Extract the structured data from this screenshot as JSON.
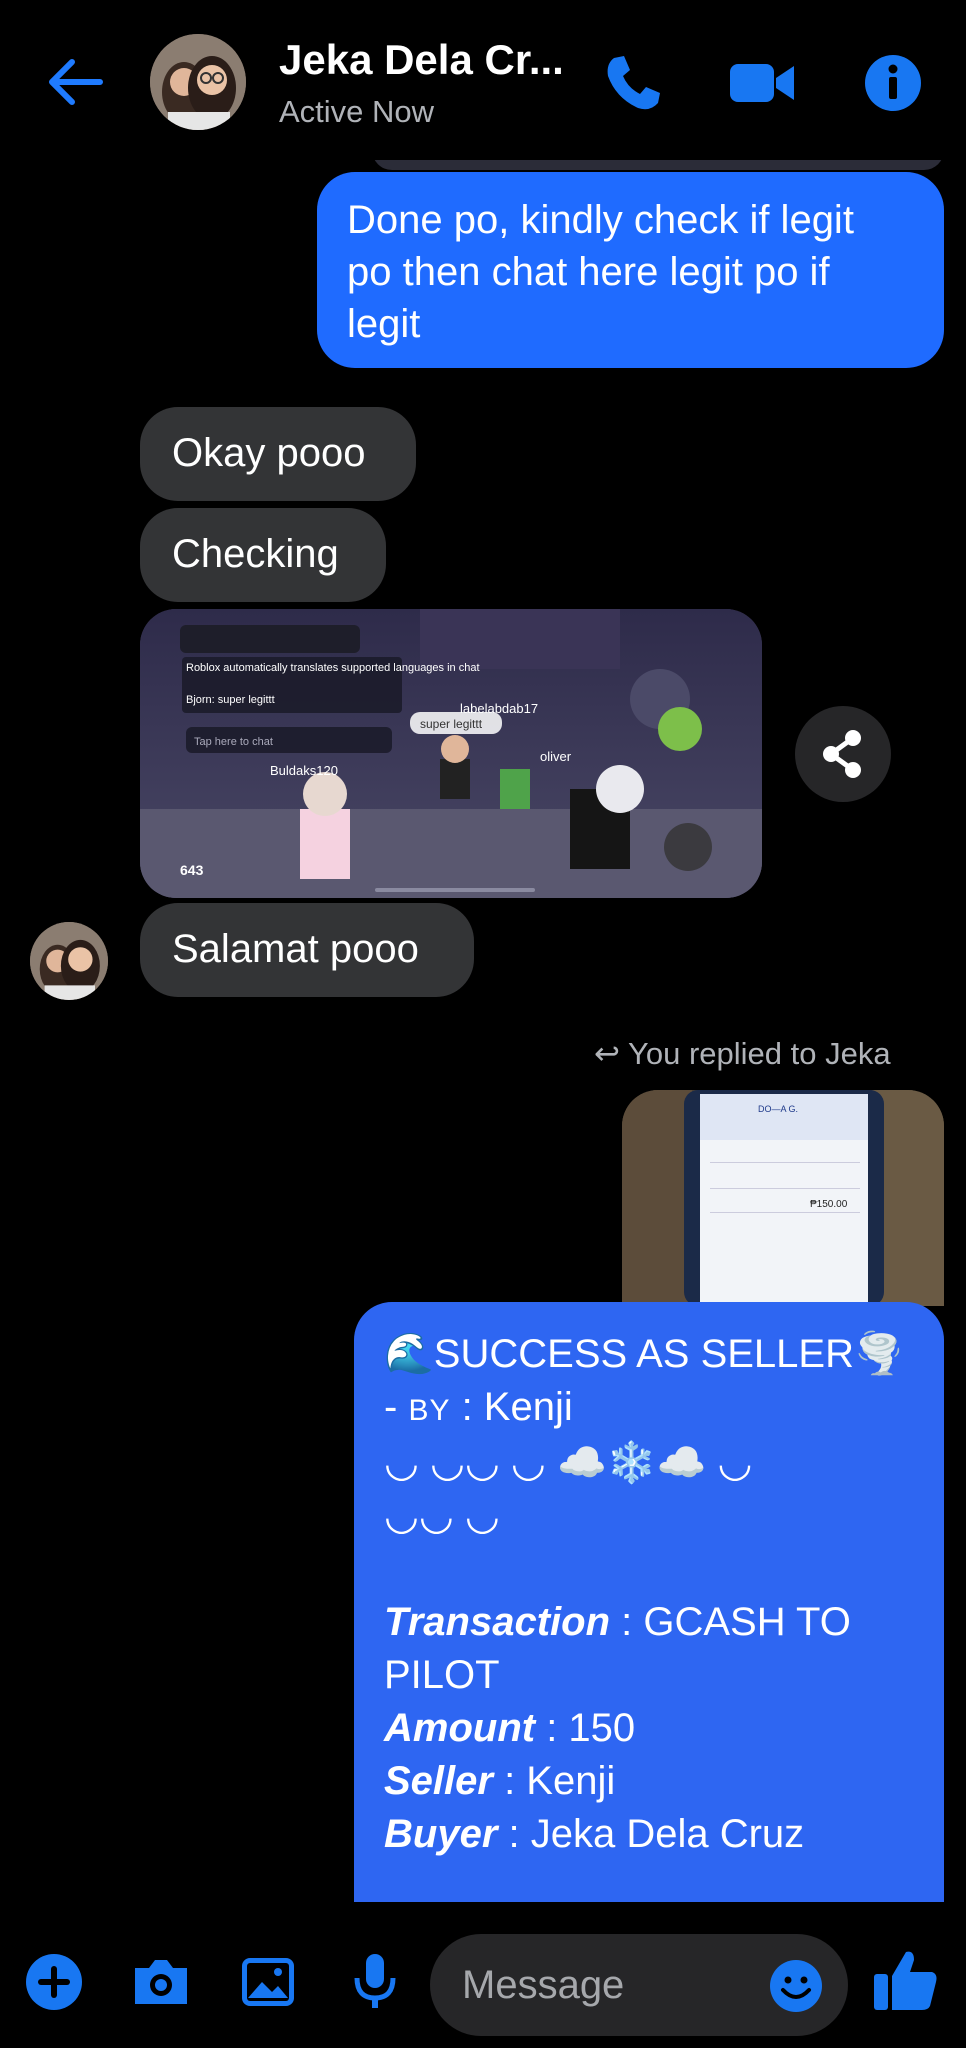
{
  "header": {
    "title": "Jeka Dela Cr...",
    "status": "Active Now",
    "icons": [
      "back-arrow-icon",
      "phone-icon",
      "video-call-icon",
      "info-icon"
    ]
  },
  "messages": [
    {
      "from": "me",
      "text": "Done po, kindly check if legit po then chat here legit po if legit",
      "lines": [
        "Done po, kindly check if legit",
        "po then chat here legit po if",
        "legit"
      ]
    },
    {
      "from": "them",
      "text": "Okay pooo"
    },
    {
      "from": "them",
      "text": "Checking"
    },
    {
      "from": "them",
      "type": "image",
      "overlay_text": {
        "chat_notice": "Roblox automatically translates supported languages in chat",
        "chat_line": "Bjorn: super legittt",
        "chat_placeholder": "Tap here to chat",
        "name_1": "Buldaks120",
        "name_2": "labelabdab17",
        "name_3": "oliver",
        "bubble": "super legittt",
        "counter": "643"
      }
    },
    {
      "from": "them",
      "text": "Salamat pooo"
    }
  ],
  "reply": {
    "note": "You replied to Jeka",
    "receipt": {
      "name": "DO—A G.",
      "amount": "₱150.00"
    }
  },
  "long_message": {
    "line1": "🌊SUCCESS AS SELLER🌪️",
    "by_prefix": "- ",
    "by_label": "BY",
    "by_value": " : Kenji",
    "decor1": "◡ ◡◡ ◡ ☁️❄️☁️ ◡",
    "decor2": "◡◡ ◡",
    "transaction_label": "Transaction",
    "transaction_value": " : GCASH TO",
    "transaction_value2": "PILOT",
    "amount_label": "Amount",
    "amount_value": " : 150",
    "seller_label": "Seller",
    "seller_value": " : Kenji",
    "buyer_label": "Buyer",
    "buyer_value": " : Jeka Dela Cruz"
  },
  "composer": {
    "placeholder": "Message",
    "icons": [
      "plus-icon",
      "camera-icon",
      "gallery-icon",
      "microphone-icon",
      "emoji-icon",
      "like-icon"
    ]
  },
  "colors": {
    "accent": "#1f6bff",
    "incoming": "#333436",
    "outgoing": "#1f6bff",
    "icon": "#1877f2"
  }
}
